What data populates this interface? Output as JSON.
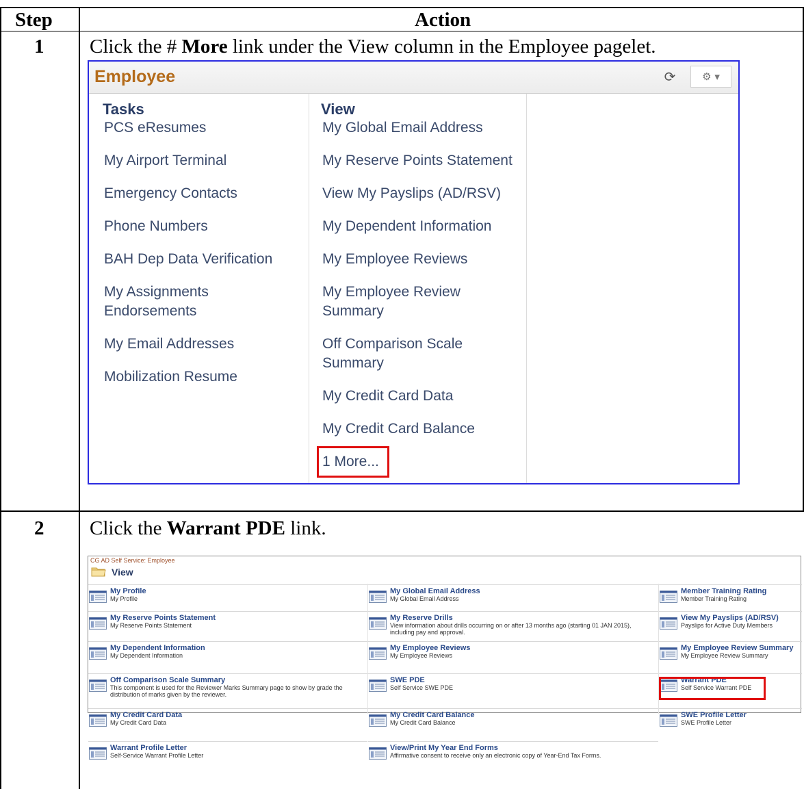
{
  "table": {
    "header_step": "Step",
    "header_action": "Action",
    "rows": [
      {
        "step": "1",
        "pre": "Click the # ",
        "bold": "More",
        "post": " link under the View column in the Employee pagelet."
      },
      {
        "step": "2",
        "pre": "Click the ",
        "bold": "Warrant PDE",
        "post": " link."
      }
    ]
  },
  "shot1": {
    "title": "Employee",
    "refresh_icon": "refresh-icon",
    "gear_icon": "gear-menu-icon",
    "tasks_heading": "Tasks",
    "view_heading": "View",
    "tasks": [
      "PCS eResumes",
      "My Airport Terminal",
      "Emergency Contacts",
      "Phone Numbers",
      "BAH Dep Data Verification",
      "My Assignments Endorsements",
      "My Email Addresses",
      "Mobilization Resume"
    ],
    "view": [
      "My Global Email Address",
      "My Reserve Points Statement",
      "View My Payslips (AD/RSV)",
      "My Dependent Information",
      "My Employee Reviews",
      "My Employee Review Summary",
      "Off Comparison Scale Summary",
      "My Credit Card Data",
      "My Credit Card Balance"
    ],
    "more_link": "1 More...",
    "highlight_color": "#e01010"
  },
  "shot2": {
    "breadcrumb": "CG AD Self Service: Employee",
    "title": "View",
    "items": [
      {
        "name": "My Profile",
        "desc": "My Profile"
      },
      {
        "name": "My Global Email Address",
        "desc": "My Global Email Address"
      },
      {
        "name": "Member Training Rating",
        "desc": "Member Training Rating"
      },
      {
        "name": "My Reserve Points Statement",
        "desc": "My Reserve Points Statement"
      },
      {
        "name": "My Reserve Drills",
        "desc": "View information about drills occurring on or after 13 months ago (starting 01 JAN 2015), including pay and approval."
      },
      {
        "name": "View My Payslips (AD/RSV)",
        "desc": "Payslips for Active Duty Members"
      },
      {
        "name": "My Dependent Information",
        "desc": "My Dependent Information"
      },
      {
        "name": "My Employee Reviews",
        "desc": "My Employee Reviews"
      },
      {
        "name": "My Employee Review Summary",
        "desc": "My Employee Review Summary"
      },
      {
        "name": "Off Comparison Scale Summary",
        "desc": "This component is used for the Reviewer Marks Summary page to show by grade the distribution of marks given by the reviewer."
      },
      {
        "name": "SWE PDE",
        "desc": "Self Service SWE PDE"
      },
      {
        "name": "Warrant PDE",
        "desc": "Self Service Warrant PDE"
      },
      {
        "name": "My Credit Card Data",
        "desc": "My Credit Card Data"
      },
      {
        "name": "My Credit Card Balance",
        "desc": "My Credit Card Balance"
      },
      {
        "name": "SWE Profile Letter",
        "desc": "SWE Profile Letter"
      },
      {
        "name": "Warrant Profile Letter",
        "desc": "Self-Service Warrant Profile Letter"
      },
      {
        "name": "View/Print My Year End Forms",
        "desc": "Affirmative consent to receive only an electronic copy of Year-End Tax Forms."
      }
    ]
  }
}
